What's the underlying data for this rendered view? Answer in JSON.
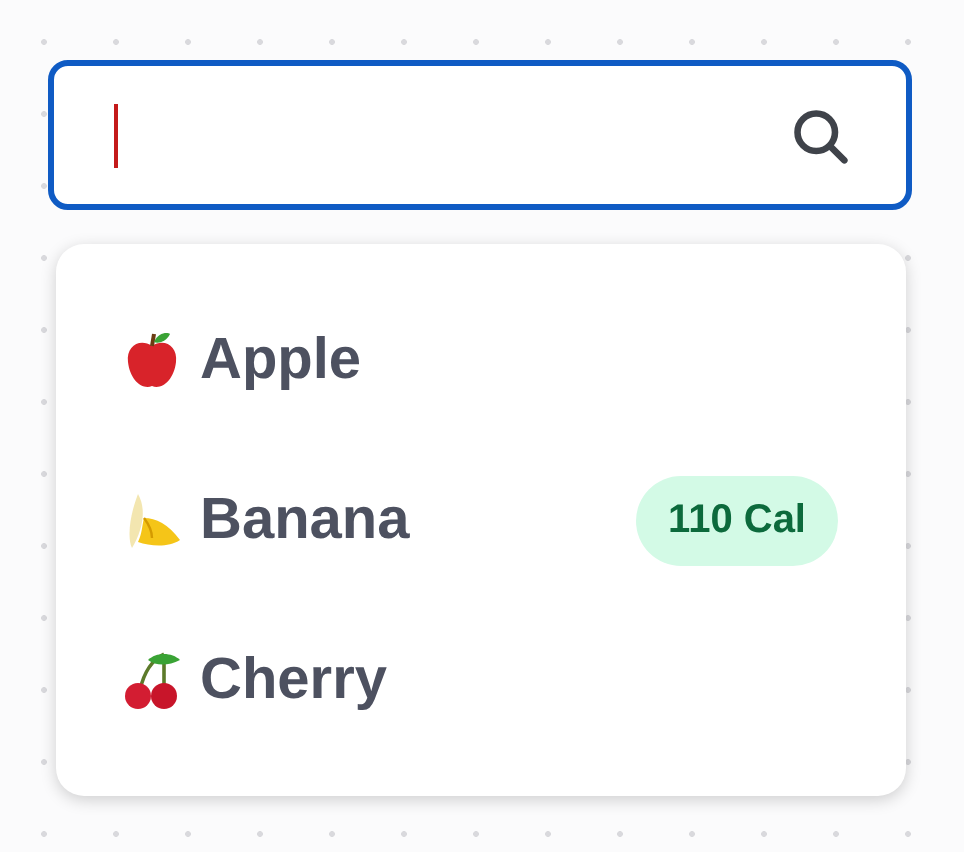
{
  "search": {
    "focused": true
  },
  "options": [
    {
      "kind": "apple",
      "label": "Apple"
    },
    {
      "kind": "banana",
      "label": "Banana",
      "badge": "110 Cal"
    },
    {
      "kind": "cherry",
      "label": "Cherry"
    }
  ]
}
